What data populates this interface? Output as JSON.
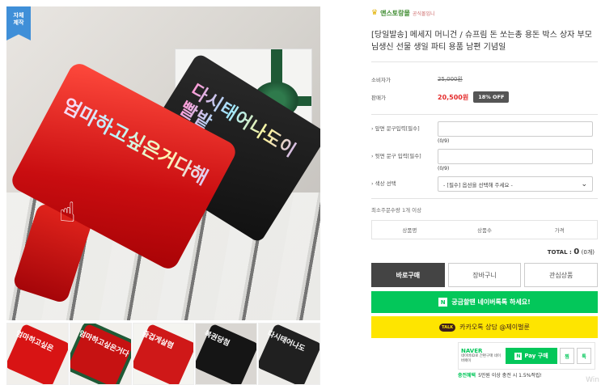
{
  "image": {
    "badge": "자체\n제작",
    "gun_black_text": "다시태어나도이빨밭",
    "gun_red_text": "엄마하고싶은거다해"
  },
  "thumbnails": [
    {
      "text": "엄마하고싶은"
    },
    {
      "text": "엄마하고싶은거다"
    },
    {
      "text": "즐겁게살렴"
    },
    {
      "text": "복권당첨"
    },
    {
      "text": "다시태어나도"
    }
  ],
  "brand": {
    "name": "앤스토랑몰",
    "sub": "공식몰입니"
  },
  "product": {
    "title": "[당일발송] 메세지 머니건 / 슈프림 돈 쏘는총 용돈 박스 상자 부모님생신 선물 생일 파티 용품 남편 기념일"
  },
  "price": {
    "consumer_label": "소비자가",
    "consumer_price": "25,000원",
    "sale_label": "판매가",
    "sale_price": "20,500원",
    "discount": "18% OFF"
  },
  "options": {
    "front_label": "앞면 문구입력[필수]",
    "front_count": "(0/9)",
    "back_label": "뒷면 문구 입력[필수]",
    "back_count": "(0/9)",
    "color_label": "색상 선택",
    "color_value": "- [필수] 옵션을 선택해 주세요 -"
  },
  "min_qty": "최소주문수량 1개 이상",
  "qty_table": {
    "col_name": "상품명",
    "col_qty": "상품수",
    "col_price": "가격"
  },
  "total": {
    "label": "TOTAL : ",
    "value": "0",
    "unit": "(0개)"
  },
  "buttons": {
    "buy": "바로구매",
    "cart": "장바구니",
    "wish": "관심상품"
  },
  "naver_talk": {
    "icon": "N",
    "label": "궁금할땐 네이버톡톡 하세요!"
  },
  "kakao": {
    "icon": "TALK",
    "label": "카카오톡 상담 @제이벌룬"
  },
  "npay": {
    "logo": "NAVER",
    "desc": "네이버ID로 간편구매 네이버페이",
    "button_n": "N",
    "button": "Pay 구매",
    "small1": "찜",
    "small2": "톡"
  },
  "event": {
    "label": "충전혜택",
    "text": "5만원 이상 충전 시 1.5%적립!"
  },
  "watermark": "Win"
}
